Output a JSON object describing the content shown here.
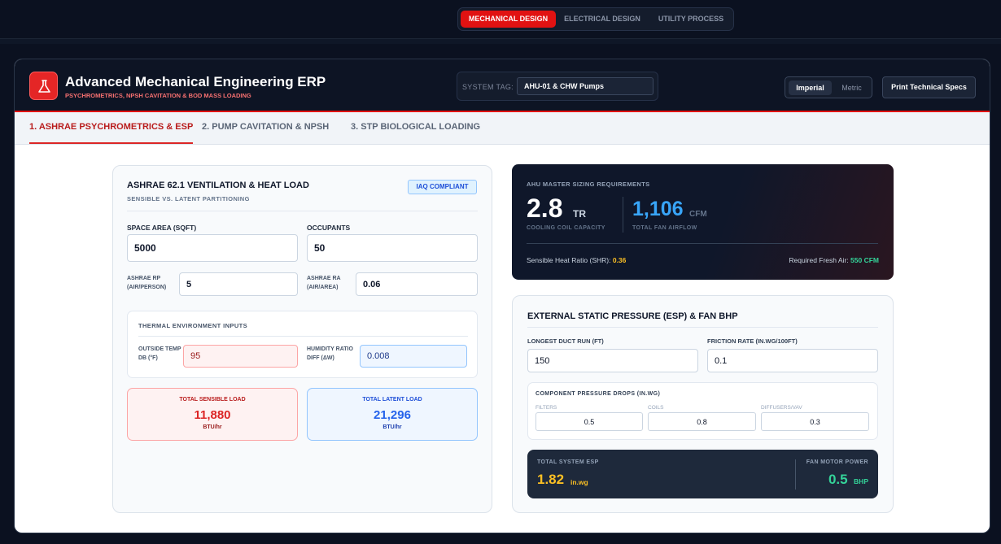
{
  "design_tabs": [
    "MECHANICAL DESIGN",
    "ELECTRICAL DESIGN",
    "UTILITY PROCESS"
  ],
  "header": {
    "title": "Advanced Mechanical Engineering ERP",
    "subtitle": "PSYCHROMETRICS, NPSH CAVITATION & BOD MASS LOADING",
    "system_tag_label": "SYSTEM TAG:",
    "system_tag_value": "AHU-01 & CHW Pumps",
    "units": [
      "Imperial",
      "Metric"
    ],
    "print_label": "Print Technical Specs"
  },
  "tabs": [
    "1. ASHRAE PSYCHROMETRICS & ESP",
    "2. PUMP CAVITATION & NPSH",
    "3. STP BIOLOGICAL LOADING"
  ],
  "ventilation": {
    "title": "ASHRAE 62.1 VENTILATION & HEAT LOAD",
    "subtitle": "SENSIBLE VS. LATENT PARTITIONING",
    "badge": "IAQ COMPLIANT",
    "space_area_label": "SPACE AREA (SQFT)",
    "space_area_value": "5000",
    "occupants_label": "OCCUPANTS",
    "occupants_value": "50",
    "rp_label_1": "ASHRAE RP",
    "rp_label_2": "(AIR/PERSON)",
    "rp_value": "5",
    "ra_label_1": "ASHRAE RA",
    "ra_label_2": "(AIR/AREA)",
    "ra_value": "0.06",
    "thermal_title": "THERMAL ENVIRONMENT INPUTS",
    "outside_label_1": "OUTSIDE TEMP",
    "outside_label_2": "DB (°F)",
    "outside_value": "95",
    "humidity_label_1": "HUMIDITY RATIO",
    "humidity_label_2": "DIFF (ΔW)",
    "humidity_value": "0.008",
    "sensible_title": "TOTAL SENSIBLE LOAD",
    "sensible_value": "11,880",
    "sensible_unit": "BTU/hr",
    "latent_title": "TOTAL LATENT LOAD",
    "latent_value": "21,296",
    "latent_unit": "BTU/hr"
  },
  "ahu": {
    "title": "AHU MASTER SIZING REQUIREMENTS",
    "tr_value": "2.8",
    "tr_unit": "TR",
    "tr_label": "COOLING COIL CAPACITY",
    "cfm_value": "1,106",
    "cfm_unit": "CFM",
    "cfm_label": "TOTAL FAN AIRFLOW",
    "shr_label": "Sensible Heat Ratio (SHR):",
    "shr_value": "0.36",
    "fresh_label": "Required Fresh Air:",
    "fresh_value": "550 CFM"
  },
  "esp": {
    "title": "EXTERNAL STATIC PRESSURE (ESP) & FAN BHP",
    "duct_label": "LONGEST DUCT RUN (FT)",
    "duct_value": "150",
    "friction_label": "FRICTION RATE (IN.WG/100FT)",
    "friction_value": "0.1",
    "components_title": "COMPONENT PRESSURE DROPS (IN.WG)",
    "filters_label": "FILTERS",
    "filters_value": "0.5",
    "coils_label": "COILS",
    "coils_value": "0.8",
    "diffusers_label": "DIFFUSERS/VAV",
    "diffusers_value": "0.3",
    "total_label": "TOTAL SYSTEM ESP",
    "total_value": "1.82",
    "total_unit": "in.wg",
    "motor_label": "FAN MOTOR POWER",
    "motor_value": "0.5",
    "motor_unit": "BHP"
  },
  "colors": {
    "accent": "#e11212",
    "navy": "#0f172a",
    "blue_value": "#38a5f8",
    "amber": "#fbbf24",
    "green": "#34d399"
  }
}
